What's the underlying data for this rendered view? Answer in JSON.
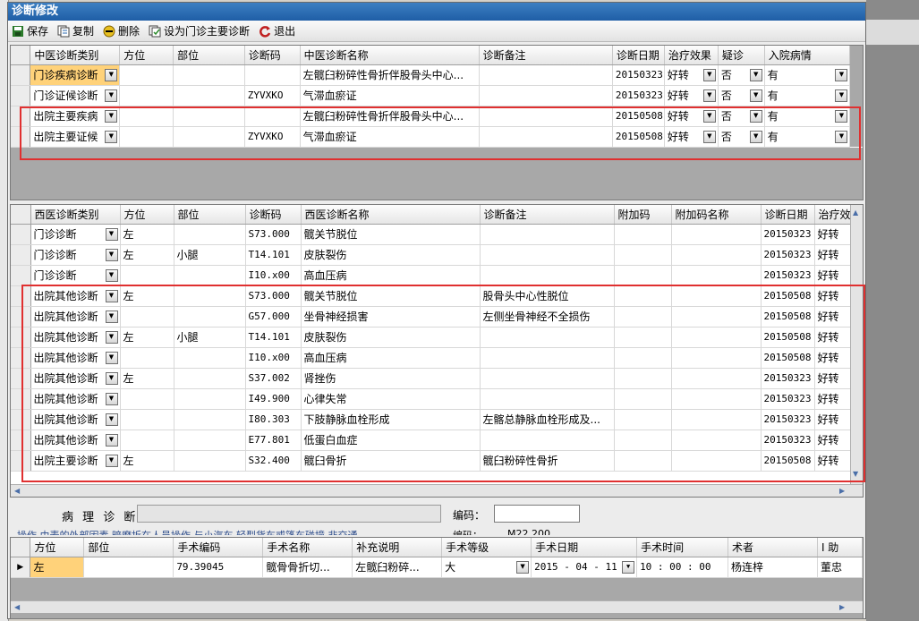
{
  "window": {
    "title": "诊断修改"
  },
  "toolbar": {
    "save": "保存",
    "copy": "复制",
    "delete": "删除",
    "set_primary": "设为门诊主要诊断",
    "exit": "退出"
  },
  "tcm": {
    "headers": [
      "中医诊断类别",
      "方位",
      "部位",
      "诊断码",
      "中医诊断名称",
      "诊断备注",
      "诊断日期",
      "治疗效果",
      "疑诊",
      "入院病情"
    ],
    "rows": [
      [
        "门诊疾病诊断",
        "",
        "",
        "",
        "左髋臼粉碎性骨折伴股骨头中心...",
        "",
        "20150323",
        "好转",
        "否",
        "有"
      ],
      [
        "门诊证候诊断",
        "",
        "",
        "ZYVXKO",
        "气滞血瘀证",
        "",
        "20150323",
        "好转",
        "否",
        "有"
      ],
      [
        "出院主要疾病",
        "",
        "",
        "",
        "左髋臼粉碎性骨折伴股骨头中心...",
        "",
        "20150508",
        "好转",
        "否",
        "有"
      ],
      [
        "出院主要证候",
        "",
        "",
        "ZYVXKO",
        "气滞血瘀证",
        "",
        "20150508",
        "好转",
        "否",
        "有"
      ]
    ]
  },
  "western": {
    "headers": [
      "西医诊断类别",
      "方位",
      "部位",
      "诊断码",
      "西医诊断名称",
      "诊断备注",
      "附加码",
      "附加码名称",
      "诊断日期",
      "治疗效"
    ],
    "rows": [
      [
        "门诊诊断",
        "左",
        "",
        "S73.000",
        "髋关节脱位",
        "",
        "",
        "",
        "20150323",
        "好转"
      ],
      [
        "门诊诊断",
        "左",
        "小腿",
        "T14.101",
        "皮肤裂伤",
        "",
        "",
        "",
        "20150323",
        "好转"
      ],
      [
        "门诊诊断",
        "",
        "",
        "I10.x00",
        "高血压病",
        "",
        "",
        "",
        "20150323",
        "好转"
      ],
      [
        "出院其他诊断",
        "左",
        "",
        "S73.000",
        "髋关节脱位",
        "股骨头中心性脱位",
        "",
        "",
        "20150508",
        "好转"
      ],
      [
        "出院其他诊断",
        "",
        "",
        "G57.000",
        "坐骨神经损害",
        "左侧坐骨神经不全损伤",
        "",
        "",
        "20150508",
        "好转"
      ],
      [
        "出院其他诊断",
        "左",
        "小腿",
        "T14.101",
        "皮肤裂伤",
        "",
        "",
        "",
        "20150508",
        "好转"
      ],
      [
        "出院其他诊断",
        "",
        "",
        "I10.x00",
        "高血压病",
        "",
        "",
        "",
        "20150508",
        "好转"
      ],
      [
        "出院其他诊断",
        "左",
        "",
        "S37.002",
        "肾挫伤",
        "",
        "",
        "",
        "20150323",
        "好转"
      ],
      [
        "出院其他诊断",
        "",
        "",
        "I49.900",
        "心律失常",
        "",
        "",
        "",
        "20150323",
        "好转"
      ],
      [
        "出院其他诊断",
        "",
        "",
        "I80.303",
        "下肢静脉血栓形成",
        "左髂总静脉血栓形成及...",
        "",
        "",
        "20150323",
        "好转"
      ],
      [
        "出院其他诊断",
        "",
        "",
        "E77.801",
        "低蛋白血症",
        "",
        "",
        "",
        "20150323",
        "好转"
      ],
      [
        "出院主要诊断",
        "左",
        "",
        "S32.400",
        "髋臼骨折",
        "髋臼粉碎性骨折",
        "",
        "",
        "20150508",
        "好转"
      ]
    ]
  },
  "pathology": {
    "label": "病 理 诊 断：",
    "code_label": "编码：",
    "code_label2": "编码：",
    "code_partial": "M22 200",
    "hidden_text": "操作  由麦的外部因素  暗磨折在人员操作  与小汽车  轻型货车或篷车碰撞  非交通"
  },
  "surgery": {
    "headers": [
      "方位",
      "部位",
      "手术编码",
      "手术名称",
      "补充说明",
      "手术等级",
      "手术日期",
      "手术时间",
      "术者",
      "I 助"
    ],
    "row": [
      "左",
      "",
      "79.39045",
      "髋骨骨折切...",
      "左髋臼粉碎...",
      "大",
      "2015 - 04 - 11",
      "10 : 00 : 00",
      "杨连梓",
      "董忠"
    ]
  },
  "colors": {
    "accent": "#1f5ea6",
    "highlight": "#ffd27a",
    "red_box": "#e03030"
  }
}
